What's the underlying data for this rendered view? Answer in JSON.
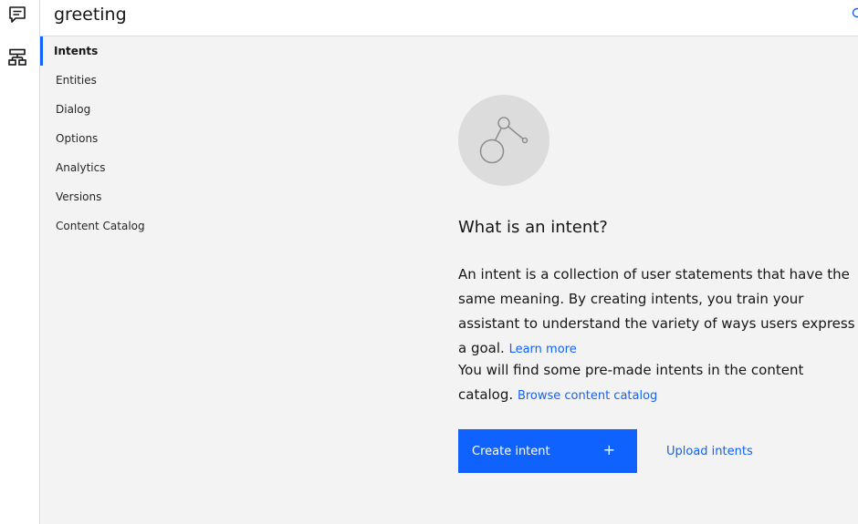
{
  "header": {
    "title": "greeting"
  },
  "rail": {
    "items": [
      {
        "icon": "chat-icon"
      },
      {
        "icon": "flowchart-icon"
      }
    ]
  },
  "nav": {
    "items": [
      {
        "label": "Intents",
        "active": true
      },
      {
        "label": "Entities"
      },
      {
        "label": "Dialog"
      },
      {
        "label": "Options"
      },
      {
        "label": "Analytics"
      },
      {
        "label": "Versions"
      },
      {
        "label": "Content Catalog"
      }
    ]
  },
  "empty_state": {
    "heading": "What is an intent?",
    "description": "An intent is a collection of user statements that have the same meaning. By creating intents, you train your assistant to understand the variety of ways users express a goal.",
    "learn_more": "Learn more",
    "catalog_text": "You will find some pre-made intents in the content catalog.",
    "browse_link": "Browse content catalog",
    "create_button": "Create intent",
    "create_icon": "+",
    "upload_button": "Upload intents"
  },
  "colors": {
    "accent": "#0f62fe",
    "background": "#f3f3f3",
    "surface": "#ffffff",
    "illustration_bg": "#dcdcdc"
  }
}
